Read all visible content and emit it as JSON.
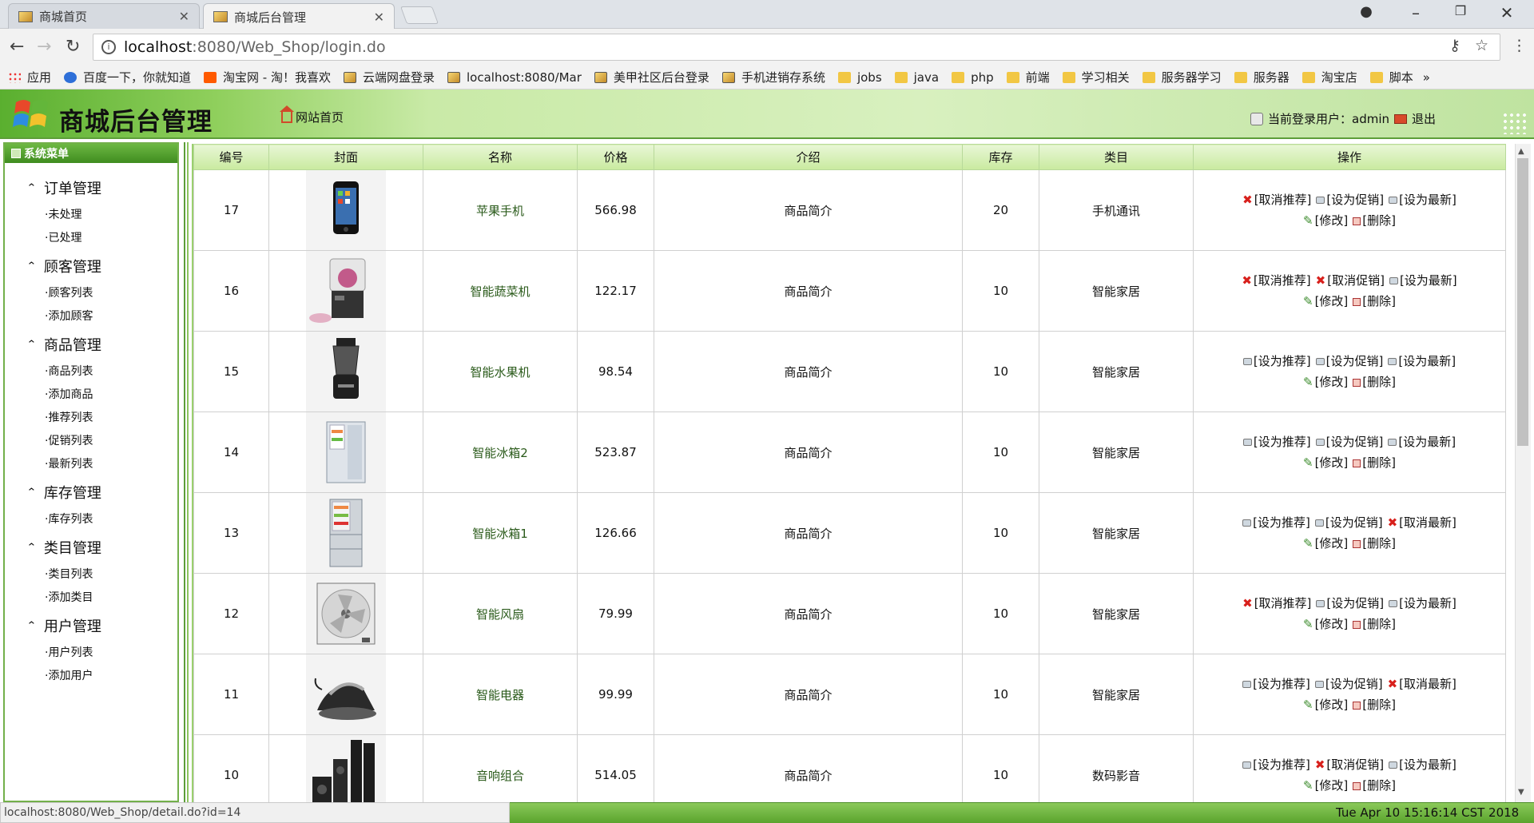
{
  "browser": {
    "tabs": [
      {
        "title": "商城首页"
      },
      {
        "title": "商城后台管理"
      }
    ],
    "url": {
      "host": "localhost",
      "path": ":8080/Web_Shop/login.do"
    },
    "bookmarks": [
      {
        "label": "应用",
        "icon": "apps-icon"
      },
      {
        "label": "百度一下，你就知道",
        "icon": "baidu-icon"
      },
      {
        "label": "淘宝网 - 淘！我喜欢",
        "icon": "taobao-icon"
      },
      {
        "label": "云端网盘登录",
        "icon": "site-icon"
      },
      {
        "label": "localhost:8080/Mar",
        "icon": "site-icon"
      },
      {
        "label": "美甲社区后台登录",
        "icon": "site-icon"
      },
      {
        "label": "手机进销存系统",
        "icon": "site-icon"
      },
      {
        "label": "jobs",
        "icon": "folder-icon"
      },
      {
        "label": "java",
        "icon": "folder-icon"
      },
      {
        "label": "php",
        "icon": "folder-icon"
      },
      {
        "label": "前端",
        "icon": "folder-icon"
      },
      {
        "label": "学习相关",
        "icon": "folder-icon"
      },
      {
        "label": "服务器学习",
        "icon": "folder-icon"
      },
      {
        "label": "服务器",
        "icon": "folder-icon"
      },
      {
        "label": "淘宝店",
        "icon": "folder-icon"
      },
      {
        "label": "脚本",
        "icon": "folder-icon"
      }
    ],
    "more": "»"
  },
  "header": {
    "title": "商城后台管理",
    "home_link": "网站首页",
    "user_label": "当前登录用户：admin",
    "logout": "退出"
  },
  "sidebar": {
    "heading": "系统菜单",
    "groups": [
      {
        "label": "订单管理",
        "items": [
          "·未处理",
          "·已处理"
        ]
      },
      {
        "label": "顾客管理",
        "items": [
          "·顾客列表",
          "·添加顾客"
        ]
      },
      {
        "label": "商品管理",
        "items": [
          "·商品列表",
          "·添加商品",
          "·推荐列表",
          "·促销列表",
          "·最新列表"
        ]
      },
      {
        "label": "库存管理",
        "items": [
          "·库存列表"
        ]
      },
      {
        "label": "类目管理",
        "items": [
          "·类目列表",
          "·添加类目"
        ]
      },
      {
        "label": "用户管理",
        "items": [
          "·用户列表",
          "·添加用户"
        ]
      }
    ]
  },
  "table": {
    "headers": [
      "编号",
      "封面",
      "名称",
      "价格",
      "介绍",
      "库存",
      "类目",
      "操作"
    ],
    "rows": [
      {
        "id": "17",
        "name": "苹果手机",
        "price": "566.98",
        "intro": "商品简介",
        "stock": "20",
        "category": "手机通讯",
        "ops": [
          "[取消推荐]",
          "[设为促销]",
          "[设为最新]"
        ],
        "cover": "phone"
      },
      {
        "id": "16",
        "name": "智能蔬菜机",
        "price": "122.17",
        "intro": "商品简介",
        "stock": "10",
        "category": "智能家居",
        "ops": [
          "[取消推荐]",
          "[取消促销]",
          "[设为最新]"
        ],
        "cover": "blender"
      },
      {
        "id": "15",
        "name": "智能水果机",
        "price": "98.54",
        "intro": "商品简介",
        "stock": "10",
        "category": "智能家居",
        "ops": [
          "[设为推荐]",
          "[设为促销]",
          "[设为最新]"
        ],
        "cover": "juicer"
      },
      {
        "id": "14",
        "name": "智能冰箱2",
        "price": "523.87",
        "intro": "商品简介",
        "stock": "10",
        "category": "智能家居",
        "ops": [
          "[设为推荐]",
          "[设为促销]",
          "[设为最新]"
        ],
        "cover": "fridge"
      },
      {
        "id": "13",
        "name": "智能冰箱1",
        "price": "126.66",
        "intro": "商品简介",
        "stock": "10",
        "category": "智能家居",
        "ops": [
          "[设为推荐]",
          "[设为促销]",
          "[取消最新]"
        ],
        "cover": "fridge2"
      },
      {
        "id": "12",
        "name": "智能风扇",
        "price": "79.99",
        "intro": "商品简介",
        "stock": "10",
        "category": "智能家居",
        "ops": [
          "[取消推荐]",
          "[设为促销]",
          "[设为最新]"
        ],
        "cover": "fan"
      },
      {
        "id": "11",
        "name": "智能电器",
        "price": "99.99",
        "intro": "商品简介",
        "stock": "10",
        "category": "智能家居",
        "ops": [
          "[设为推荐]",
          "[设为促销]",
          "[取消最新]"
        ],
        "cover": "iron"
      },
      {
        "id": "10",
        "name": "音响组合",
        "price": "514.05",
        "intro": "商品简介",
        "stock": "10",
        "category": "数码影音",
        "ops": [
          "[设为推荐]",
          "[取消促销]",
          "[设为最新]"
        ],
        "cover": "speakers"
      }
    ],
    "edit_label": "[修改]",
    "delete_label": "[删除]"
  },
  "status": {
    "url": "localhost:8080/Web_Shop/detail.do?id=14",
    "clock": "Tue Apr 10 15:16:14 CST 2018"
  },
  "colors": {
    "accent": "#5d9e39",
    "cancel_x": "#d8201c",
    "link": "#2a5a1a"
  }
}
